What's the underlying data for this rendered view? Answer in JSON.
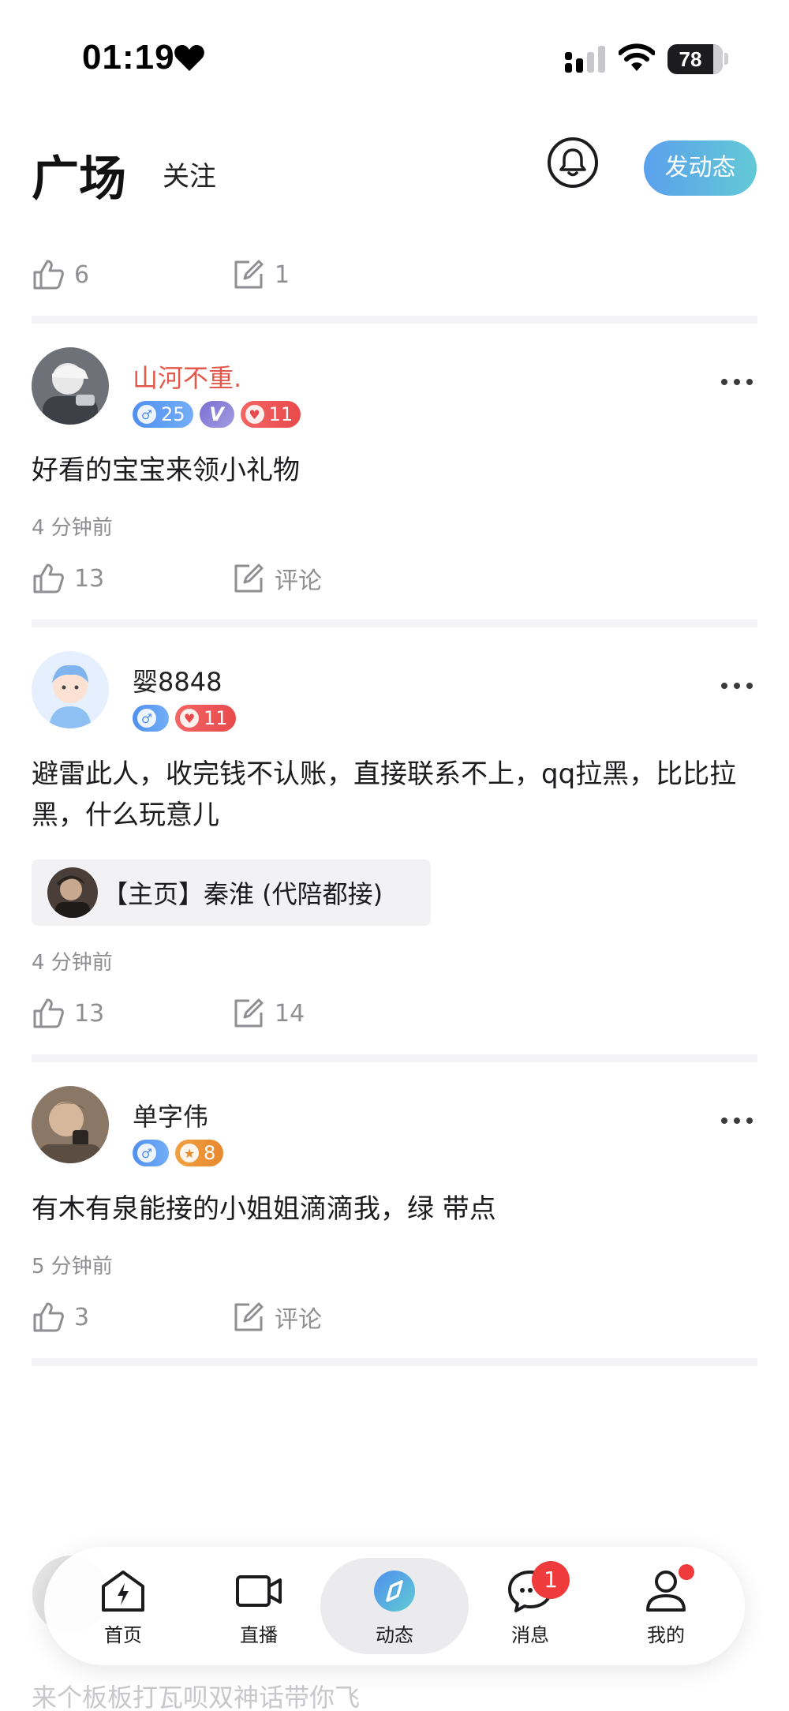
{
  "status_bar": {
    "time": "01:19",
    "battery": "78"
  },
  "header": {
    "tab_square": "广场",
    "tab_follow": "关注",
    "post_button": "发动态"
  },
  "top_stats": {
    "likes": "6",
    "comments": "1"
  },
  "posts": [
    {
      "username": "山河不重.",
      "badges": {
        "level": "25",
        "vip": "V",
        "heart": "11"
      },
      "text": "好看的宝宝来领小礼物",
      "time": "4 分钟前",
      "likes": "13",
      "comments": "评论"
    },
    {
      "username": "婴8848",
      "badges": {
        "level": "",
        "heart": "11"
      },
      "text": "避雷此人，收完钱不认账，直接联系不上，qq拉黑，比比拉黑，什么玩意儿",
      "linked": "【主页】秦淮 (代陪都接)",
      "time": "4 分钟前",
      "likes": "13",
      "comments": "14"
    },
    {
      "username": "单字伟",
      "badges": {
        "level": "",
        "star": "8"
      },
      "text": "有木有泉能接的小姐姐滴滴我，绿 带点",
      "time": "5 分钟前",
      "likes": "3",
      "comments": "评论"
    }
  ],
  "faded_post": {
    "text": "来个板板打瓦呗双神话带你飞"
  },
  "tabbar": {
    "home": "首页",
    "live": "直播",
    "moments": "动态",
    "messages": "消息",
    "messages_badge": "1",
    "mine": "我的"
  },
  "colors": {
    "accent_start": "#5aa0ec",
    "accent_end": "#63c9d6",
    "username_red": "#e3584a",
    "badge_red": "#ef3b3b"
  },
  "icons": [
    "heart-icon",
    "signal-icon",
    "wifi-icon",
    "bell-icon",
    "like-icon",
    "comment-icon",
    "more-icon",
    "home-icon",
    "video-icon",
    "compass-icon",
    "chat-icon",
    "person-icon"
  ]
}
